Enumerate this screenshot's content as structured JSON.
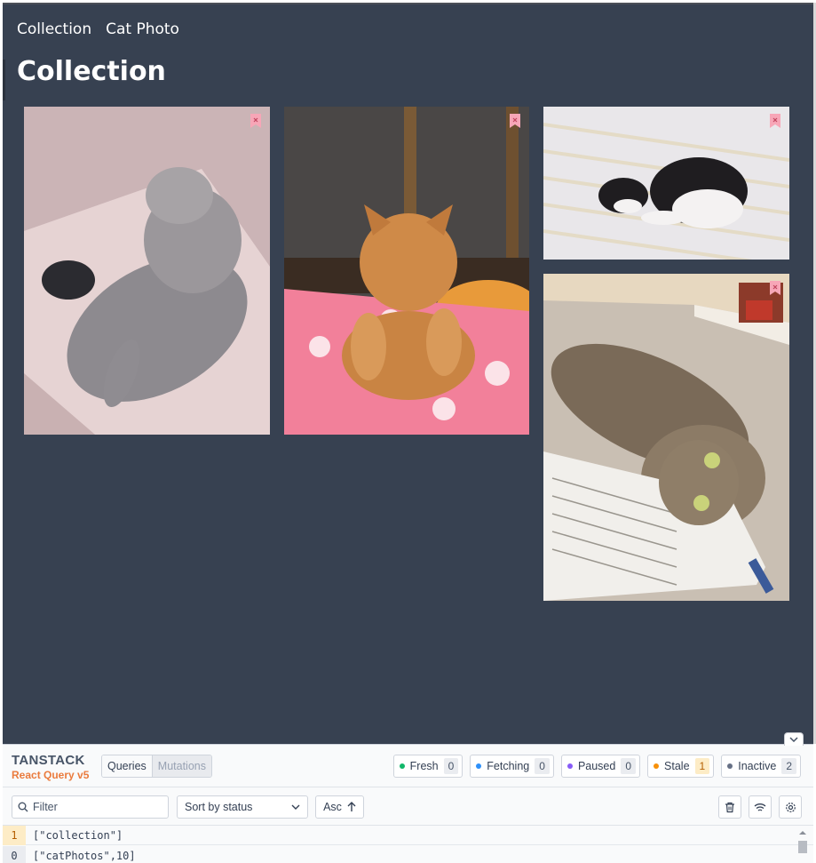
{
  "nav": {
    "collection": "Collection",
    "cat_photo": "Cat Photo"
  },
  "page": {
    "title": "Collection"
  },
  "photos": [
    {
      "subject": "tabby cat lying in cardboard box",
      "bookmarked": true
    },
    {
      "subject": "orange tabby cat on pink polka-dot blanket",
      "bookmarked": true
    },
    {
      "subject": "black and white cat sleeping on bed",
      "bookmarked": true
    },
    {
      "subject": "tabby cat lying on open book",
      "bookmarked": true
    }
  ],
  "devtools": {
    "brand": "TANSTACK",
    "sub_brand": "React Query v5",
    "tabs": {
      "queries": "Queries",
      "mutations": "Mutations"
    },
    "counts": [
      {
        "label": "Fresh",
        "value": "0",
        "color": "#12b76a"
      },
      {
        "label": "Fetching",
        "value": "0",
        "color": "#2e90fa"
      },
      {
        "label": "Paused",
        "value": "0",
        "color": "#875bf7"
      },
      {
        "label": "Stale",
        "value": "1",
        "color": "#f79009"
      },
      {
        "label": "Inactive",
        "value": "2",
        "color": "#667085"
      }
    ],
    "filter_placeholder": "Filter",
    "sort_label": "Sort by status",
    "order_label": "Asc",
    "queries": [
      {
        "count": "1",
        "key": "[\"collection\"]",
        "status_color": "#fdecc6"
      },
      {
        "count": "0",
        "key": "[\"catPhotos\",10]",
        "status_color": "#eaecf0"
      }
    ]
  },
  "icons": {
    "bookmark": "bookmark-icon",
    "search": "search-icon",
    "chevron_down": "chevron-down-icon",
    "arrow_up": "arrow-up-icon",
    "trash": "trash-icon",
    "wifi": "wifi-icon",
    "settings": "gear-icon"
  }
}
